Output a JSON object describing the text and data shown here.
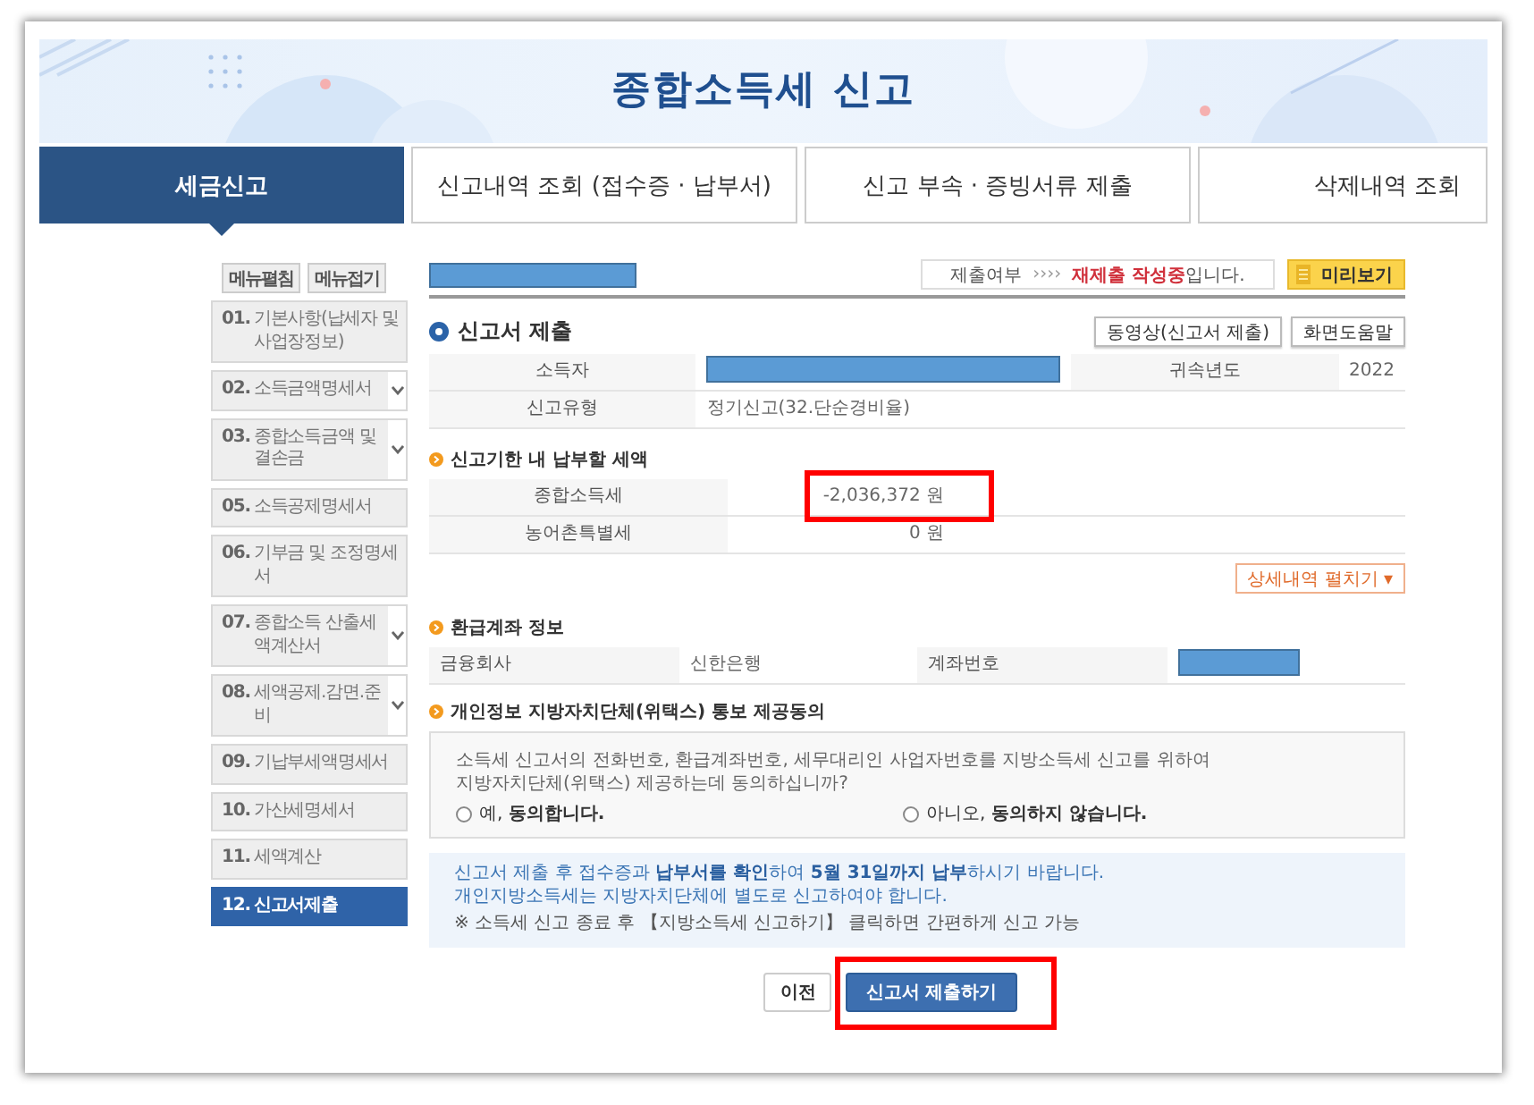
{
  "header": {
    "title": "종합소득세 신고"
  },
  "tabs": [
    {
      "label": "세금신고",
      "selected": true
    },
    {
      "label": "신고내역 조회 (접수증 · 납부서)",
      "selected": false
    },
    {
      "label": "신고 부속 · 증빙서류 제출",
      "selected": false
    },
    {
      "label": "삭제내역 조회",
      "selected": false
    }
  ],
  "sidebar": {
    "buttons": [
      "메뉴펼침",
      "메뉴접기"
    ],
    "items": [
      {
        "number": "01.",
        "label": "기본사항(납세자 및 사업장정보)",
        "expandable": false,
        "selected": false
      },
      {
        "number": "02.",
        "label": "소득금액명세서",
        "expandable": true,
        "selected": false
      },
      {
        "number": "03.",
        "label": "종합소득금액 및 결손금",
        "expandable": true,
        "selected": false
      },
      {
        "number": "05.",
        "label": "소득공제명세서",
        "expandable": false,
        "selected": false
      },
      {
        "number": "06.",
        "label": "기부금 및 조정명세서",
        "expandable": false,
        "selected": false
      },
      {
        "number": "07.",
        "label": "종합소득 산출세액계산서",
        "expandable": true,
        "selected": false
      },
      {
        "number": "08.",
        "label": "세액공제.감면.준비",
        "expandable": true,
        "selected": false
      },
      {
        "number": "09.",
        "label": "기납부세액명세서",
        "expandable": false,
        "selected": false
      },
      {
        "number": "10.",
        "label": "가산세명세서",
        "expandable": false,
        "selected": false
      },
      {
        "number": "11.",
        "label": "세액계산",
        "expandable": false,
        "selected": false
      },
      {
        "number": "12.",
        "label": "신고서제출",
        "expandable": false,
        "selected": true
      }
    ]
  },
  "top_field": {
    "redacted": true
  },
  "status": {
    "label": "제출여부",
    "arrows": "››››",
    "message": "**재제출 작성중**입니다.",
    "preview_button": "미리보기"
  },
  "form": {
    "title": "신고서 제출",
    "buttons": [
      "동영상(신고서 제출)",
      "화면도움말"
    ],
    "rows": [
      [
        {
          "label": "소득자",
          "redacted": true
        },
        {
          "label": "귀속년도",
          "value": "2022"
        }
      ],
      [
        {
          "label": "신고유형",
          "value": "정기신고(32.단순경비율)"
        }
      ]
    ]
  },
  "tax_section": {
    "title": "신고기한 내 납부할 세액",
    "rows": [
      {
        "label": "종합소득세",
        "value": "-2,036,372 원",
        "highlighted": true
      },
      {
        "label": "농어촌특별세",
        "value": "0 원"
      }
    ],
    "detail_button": {
      "label": "상세내역 펼치기",
      "caret": "▾"
    }
  },
  "refund_section": {
    "title": "환급계좌 정보",
    "fields": [
      {
        "label": "금융회사",
        "value": "신한은행"
      },
      {
        "label": "계좌번호",
        "redacted": true
      }
    ]
  },
  "consent_section": {
    "title": "개인정보 지방자치단체(위택스) 통보 제공동의",
    "question": [
      "소득세 신고서의 전화번호, 환급계좌번호, 세무대리인 사업자번호를 지방소득세 신고를 위하여",
      "지방자치단체(위택스) 제공하는데 동의하십니까?"
    ],
    "options": [
      {
        "label": "예, **동의합니다.**",
        "selected": false
      },
      {
        "label": "아니오, **동의하지 않습니다.**",
        "selected": false
      }
    ]
  },
  "notice": {
    "lines": [
      "신고서 제출 후 접수증과 **납부서를 확인**하여 **5월 31일까지 납부**하시기 바랍니다.",
      "개인지방소득세는 지방자치단체에 별도로 신고하여야 합니다."
    ],
    "note": "※ 소득세 신고 종료 후 【지방소득세 신고하기】 클릭하면 간편하게 신고 가능"
  },
  "actions": [
    {
      "label": "이전",
      "kind": "secondary"
    },
    {
      "label": "신고서 제출하기",
      "kind": "primary",
      "highlighted": true
    }
  ]
}
